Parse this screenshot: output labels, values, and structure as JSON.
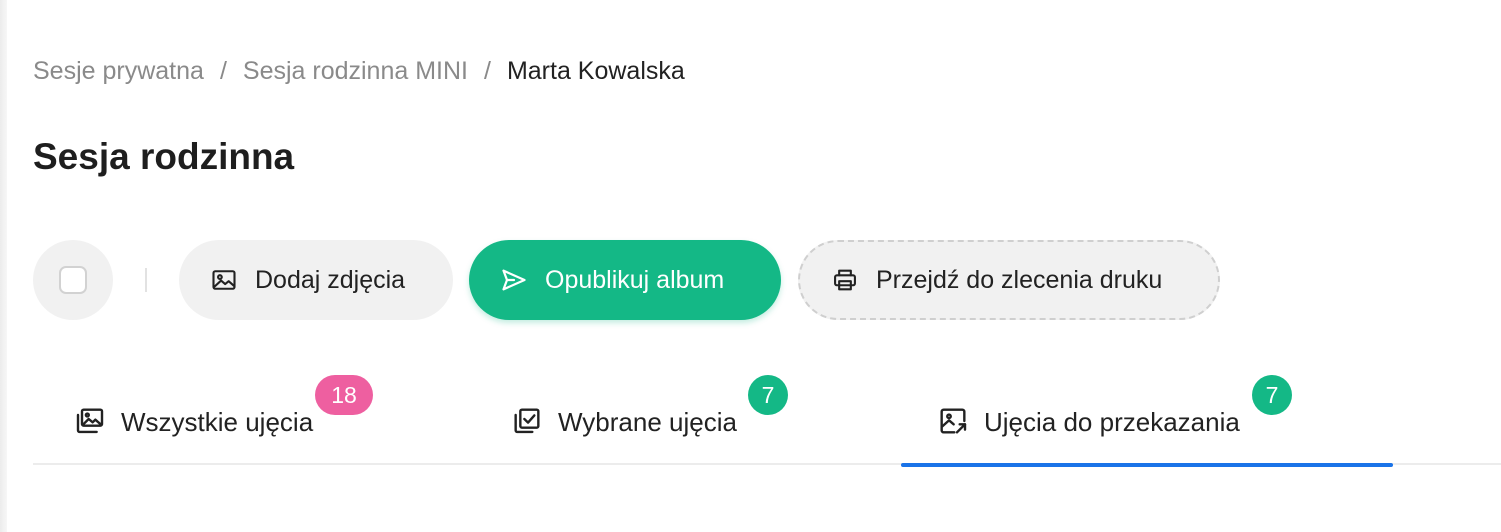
{
  "breadcrumb": {
    "items": [
      {
        "label": "Sesje prywatna"
      },
      {
        "label": "Sesja rodzinna MINI"
      },
      {
        "label": "Marta Kowalska"
      }
    ],
    "separator": "/"
  },
  "page": {
    "title": "Sesja rodzinna"
  },
  "toolbar": {
    "add_photos": {
      "label": "Dodaj zdjęcia",
      "icon": "image-icon"
    },
    "publish": {
      "label": "Opublikuj album",
      "icon": "send-icon",
      "color": "#14b886"
    },
    "print": {
      "label": "Przejdź do zlecenia druku",
      "icon": "printer-icon"
    }
  },
  "tabs": [
    {
      "label": "Wszystkie ujęcia",
      "badge": "18",
      "badge_color": "#ee5fa0",
      "icon": "photo-library-icon",
      "active": false
    },
    {
      "label": "Wybrane ujęcia",
      "badge": "7",
      "badge_color": "#14b886",
      "icon": "checked-library-icon",
      "active": false
    },
    {
      "label": "Ujęcia do przekazania",
      "badge": "7",
      "badge_color": "#14b886",
      "icon": "image-share-icon",
      "active": true
    }
  ],
  "colors": {
    "accent": "#1a73e8",
    "primary": "#14b886"
  }
}
